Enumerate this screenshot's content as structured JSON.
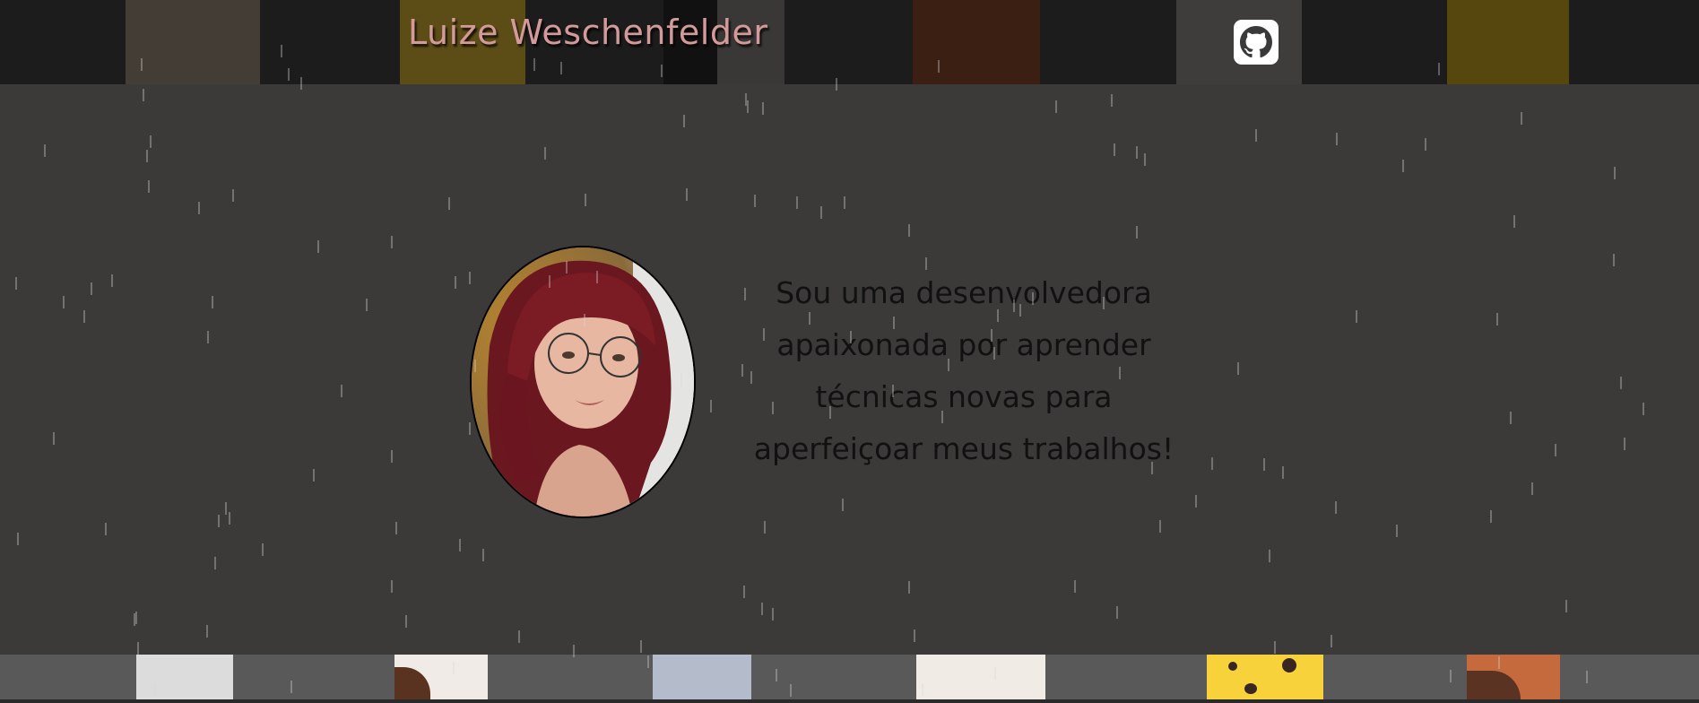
{
  "header": {
    "title": "Luize Weschenfelder",
    "github_icon": "github-icon"
  },
  "main": {
    "avatar_alt": "profile photo",
    "bio_lines": [
      "Sou uma desenvolvedora",
      "apaixonada por aprender",
      "técnicas novas para",
      "aperfeiçoar meus trabalhos!"
    ]
  },
  "colors": {
    "background": "#3b3a39",
    "header_bg": "#1c1c1c",
    "title": "#d49a9a",
    "footer_bg": "#595959"
  }
}
